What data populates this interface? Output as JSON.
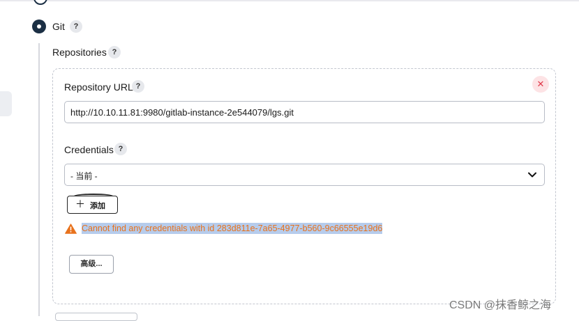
{
  "scm": {
    "option_label": "Git",
    "help_symbol": "?"
  },
  "repositories": {
    "label": "Repositories",
    "help_symbol": "?",
    "close_symbol": "✕"
  },
  "repository_url": {
    "label": "Repository URL",
    "help_symbol": "?",
    "value": "http://10.10.11.81:9980/gitlab-instance-2e544079/lgs.git"
  },
  "credentials": {
    "label": "Credentials",
    "help_symbol": "?",
    "selected": "- 当前 -",
    "add_button_label": "添加",
    "add_button_icon": "＋",
    "warning_text": "Cannot find any credentials with id 283d811e-7a65-4977-b560-9c66555e19d6",
    "warning_color": "#e8721c"
  },
  "advanced_button_label": "高级...",
  "watermark": "CSDN @抹香鲸之海",
  "colors": {
    "radio": "#1b2f44",
    "close_bg": "#fde3e5",
    "close_fg": "#e03a4a",
    "highlight": "#b6ccec"
  },
  "icons": {
    "warning": "warning-triangle-icon",
    "chevron": "chevron-down-icon",
    "close": "close-icon",
    "plus": "plus-icon"
  }
}
